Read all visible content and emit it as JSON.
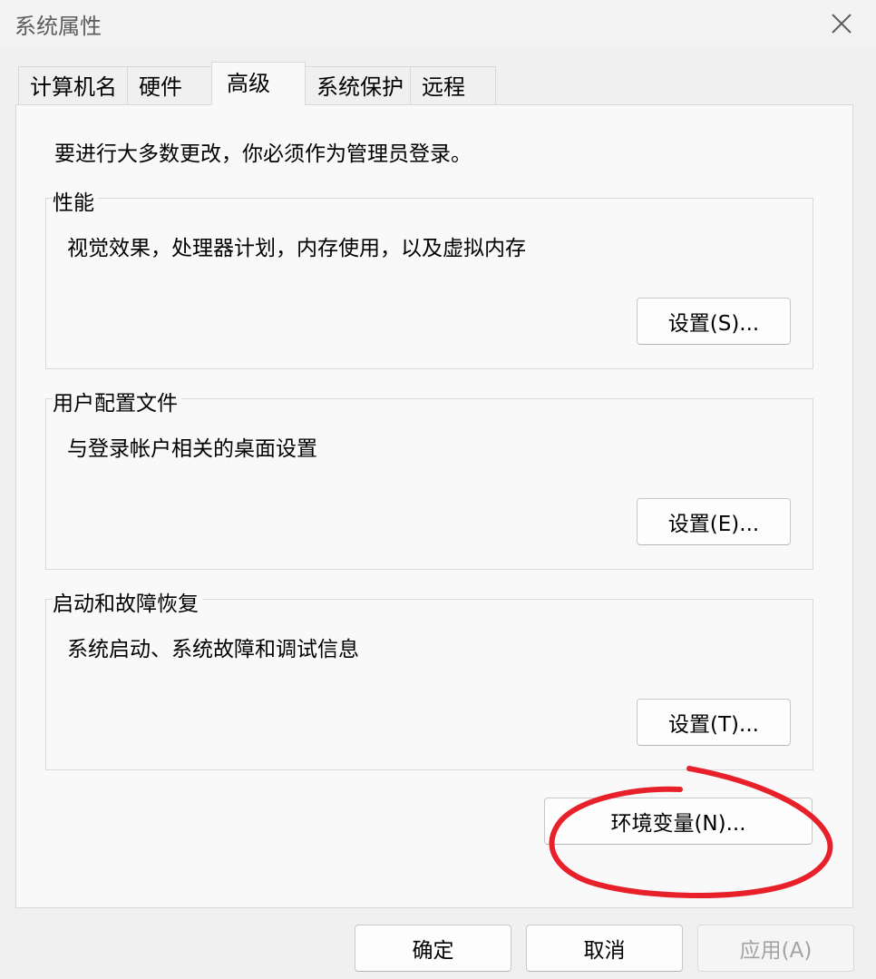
{
  "window": {
    "title": "系统属性"
  },
  "tabs": [
    {
      "label": "计算机名",
      "active": false
    },
    {
      "label": "硬件",
      "active": false
    },
    {
      "label": "高级",
      "active": true
    },
    {
      "label": "系统保护",
      "active": false
    },
    {
      "label": "远程",
      "active": false
    }
  ],
  "notice": "要进行大多数更改，你必须作为管理员登录。",
  "groups": {
    "performance": {
      "label": "性能",
      "description": "视觉效果，处理器计划，内存使用，以及虚拟内存",
      "button": "设置(S)..."
    },
    "user_profiles": {
      "label": "用户配置文件",
      "description": "与登录帐户相关的桌面设置",
      "button": "设置(E)..."
    },
    "startup_recovery": {
      "label": "启动和故障恢复",
      "description": "系统启动、系统故障和调试信息",
      "button": "设置(T)..."
    }
  },
  "env_button": "环境变量(N)...",
  "footer": {
    "ok": "确定",
    "cancel": "取消",
    "apply": "应用(A)"
  },
  "colors": {
    "annotation_circle": "#e8202a"
  },
  "icons": {
    "close": "close-icon"
  }
}
